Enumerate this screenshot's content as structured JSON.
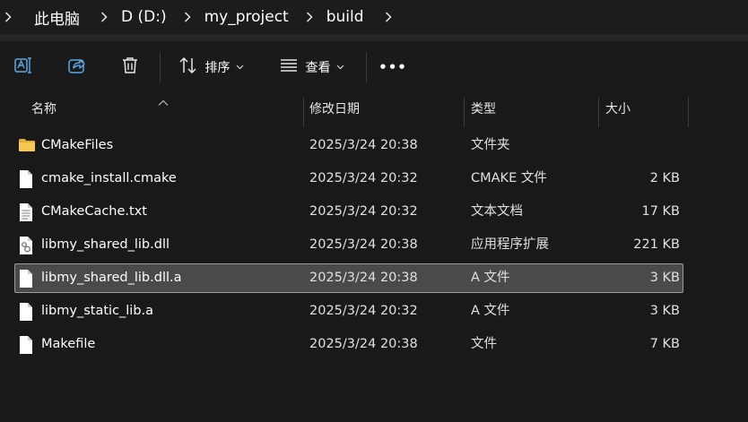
{
  "breadcrumb": {
    "items": [
      {
        "label": "此电脑"
      },
      {
        "label": "D (D:)"
      },
      {
        "label": "my_project"
      },
      {
        "label": "build"
      }
    ]
  },
  "toolbar": {
    "sort_label": "排序",
    "view_label": "查看",
    "more_label": "•••"
  },
  "columns": {
    "name": "名称",
    "modified": "修改日期",
    "type": "类型",
    "size": "大小"
  },
  "files": [
    {
      "name": "CMakeFiles",
      "modified": "2025/3/24 20:38",
      "type": "文件夹",
      "size": "",
      "icon": "folder-icon"
    },
    {
      "name": "cmake_install.cmake",
      "modified": "2025/3/24 20:32",
      "type": "CMAKE 文件",
      "size": "2 KB",
      "icon": "file-icon"
    },
    {
      "name": "CMakeCache.txt",
      "modified": "2025/3/24 20:32",
      "type": "文本文档",
      "size": "17 KB",
      "icon": "text-file-icon"
    },
    {
      "name": "libmy_shared_lib.dll",
      "modified": "2025/3/24 20:38",
      "type": "应用程序扩展",
      "size": "221 KB",
      "icon": "dll-file-icon"
    },
    {
      "name": "libmy_shared_lib.dll.a",
      "modified": "2025/3/24 20:38",
      "type": "A 文件",
      "size": "3 KB",
      "icon": "file-icon",
      "selected": true
    },
    {
      "name": "libmy_static_lib.a",
      "modified": "2025/3/24 20:32",
      "type": "A 文件",
      "size": "3 KB",
      "icon": "file-icon"
    },
    {
      "name": "Makefile",
      "modified": "2025/3/24 20:38",
      "type": "文件",
      "size": "7 KB",
      "icon": "file-icon"
    }
  ],
  "colors": {
    "background": "#191919",
    "selected_row": "#4a4a4a",
    "folder": "#f4c24a",
    "accent_blue": "#5aa9e6"
  }
}
